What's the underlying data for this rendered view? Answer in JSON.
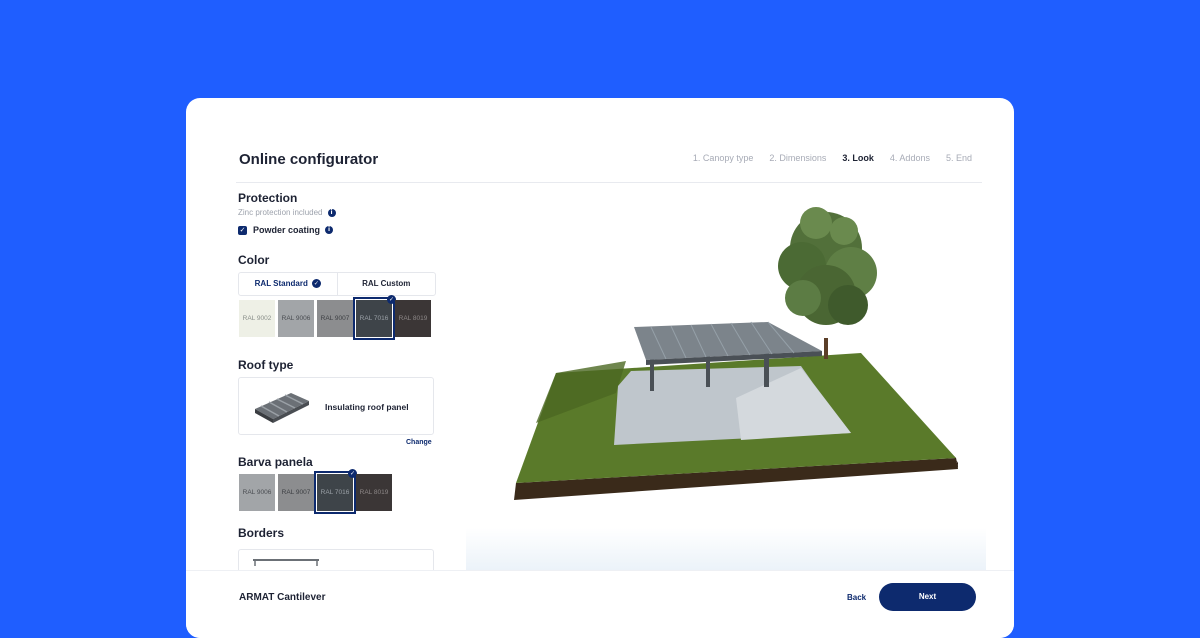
{
  "header": {
    "title": "Online configurator",
    "steps": [
      {
        "label": "1. Canopy type",
        "active": false
      },
      {
        "label": "2. Dimensions",
        "active": false
      },
      {
        "label": "3. Look",
        "active": true
      },
      {
        "label": "4. Addons",
        "active": false
      },
      {
        "label": "5. End",
        "active": false
      }
    ]
  },
  "protection": {
    "title": "Protection",
    "subtitle": "Zinc protection included",
    "checkbox_label": "Powder coating",
    "checked": true
  },
  "color": {
    "title": "Color",
    "tabs": [
      {
        "label": "RAL Standard",
        "selected": true
      },
      {
        "label": "RAL Custom",
        "selected": false
      }
    ],
    "swatches": [
      {
        "label": "RAL 9002",
        "color": "#eef0e6",
        "text_color": "#8a8f8a",
        "selected": false
      },
      {
        "label": "RAL 9006",
        "color": "#a2a5a8",
        "text_color": "#4a4d52",
        "selected": false
      },
      {
        "label": "RAL 9007",
        "color": "#8c8d8f",
        "text_color": "#3d3f43",
        "selected": false
      },
      {
        "label": "RAL 7016",
        "color": "#3e4449",
        "text_color": "#9aa0a6",
        "selected": true
      },
      {
        "label": "RAL 8019",
        "color": "#3b3636",
        "text_color": "#8c8787",
        "selected": false
      }
    ]
  },
  "roof": {
    "title": "Roof type",
    "label": "Insulating roof panel",
    "change_label": "Change"
  },
  "panel_color": {
    "title": "Barva panela",
    "swatches": [
      {
        "label": "RAL 9006",
        "color": "#a2a5a8",
        "text_color": "#4a4d52",
        "selected": false
      },
      {
        "label": "RAL 9007",
        "color": "#8c8d8f",
        "text_color": "#3d3f43",
        "selected": false
      },
      {
        "label": "RAL 7016",
        "color": "#3e4449",
        "text_color": "#9aa0a6",
        "selected": true
      },
      {
        "label": "RAL 8019",
        "color": "#3b3636",
        "text_color": "#8c8787",
        "selected": false
      }
    ]
  },
  "borders": {
    "title": "Borders"
  },
  "footer": {
    "product": "ARMAT Cantilever",
    "back_label": "Back",
    "next_label": "Next"
  },
  "colors": {
    "background": "#1f5eff",
    "accent": "#0d2a6e",
    "grass": "#5a7a2a",
    "soil": "#3a2a1a"
  }
}
